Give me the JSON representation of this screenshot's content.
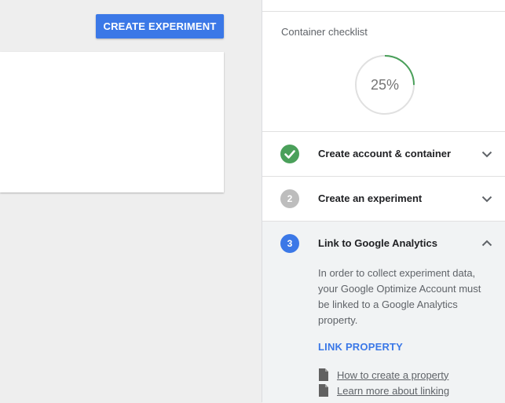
{
  "toolbar": {
    "create_experiment_label": "CREATE EXPERIMENT"
  },
  "checklist": {
    "title": "Container checklist",
    "progress_percent": 25,
    "progress_text": "25%",
    "steps": [
      {
        "number": "",
        "label": "Create account & container",
        "status": "done"
      },
      {
        "number": "2",
        "label": "Create an experiment",
        "status": "todo"
      },
      {
        "number": "3",
        "label": "Link to Google Analytics",
        "status": "active",
        "description": "In order to collect experiment data, your Google Optimize Account must be linked to a Google Analytics property.",
        "action_label": "LINK PROPERTY",
        "links": [
          {
            "label": "How to create a property",
            "icon": "document-icon"
          },
          {
            "label": "Learn more about linking",
            "icon": "document-icon"
          }
        ]
      }
    ]
  },
  "colors": {
    "primary": "#3b78e7",
    "success": "#4aa05a",
    "inactive": "#bdbdbd"
  }
}
